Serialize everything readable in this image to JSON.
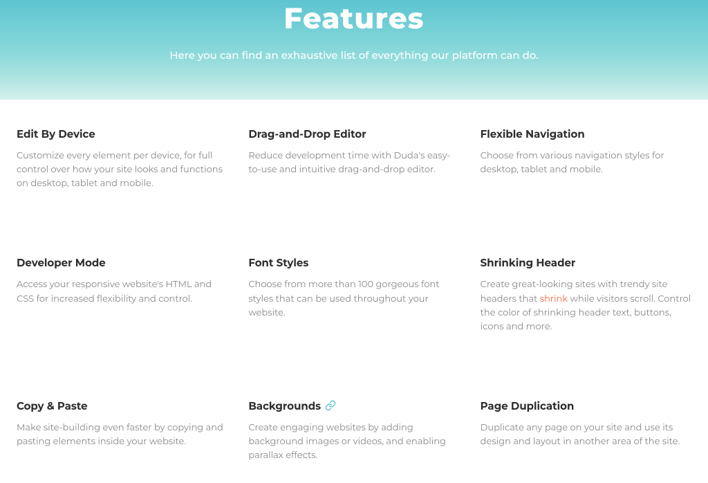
{
  "hero": {
    "title": "Features",
    "subtitle": "Here you can find an exhaustive list of everything our platform can do."
  },
  "features": [
    {
      "title": "Edit By Device",
      "description": "Customize every element per device, for full control over how your site looks and functions on desktop, tablet and mobile.",
      "hasIcon": false,
      "hasLink": false
    },
    {
      "title": "Drag-and-Drop Editor",
      "description": "Reduce development time with Duda's easy-to-use and intuitive drag-and-drop editor.",
      "hasIcon": false,
      "hasLink": false
    },
    {
      "title": "Flexible Navigation",
      "description": "Choose from various navigation styles for desktop, tablet and mobile.",
      "hasIcon": false,
      "hasLink": false
    },
    {
      "title": "Developer Mode",
      "description": "Access your responsive website's HTML and CSS for increased flexibility and control.",
      "hasIcon": false,
      "hasLink": false
    },
    {
      "title": "Font Styles",
      "description": "Choose from more than 100 gorgeous font styles that can be used throughout your website.",
      "hasIcon": false,
      "hasLink": false
    },
    {
      "title": "Shrinking Header",
      "descriptionBefore": "Create great-looking sites with trendy site headers that ",
      "linkText": "shrink",
      "descriptionAfter": " while visitors scroll. Control the color of shrinking header text, buttons, icons and more.",
      "hasIcon": false,
      "hasLink": true
    },
    {
      "title": "Copy & Paste",
      "description": "Make site-building even faster by copying and pasting elements inside your website.",
      "hasIcon": false,
      "hasLink": false
    },
    {
      "title": "Backgrounds",
      "description": "Create engaging websites by adding background images or videos, and enabling parallax effects.",
      "hasIcon": true,
      "hasLink": false
    },
    {
      "title": "Page Duplication",
      "description": "Duplicate any page on your site and use its design and layout in another area of the site.",
      "hasIcon": false,
      "hasLink": false
    }
  ]
}
